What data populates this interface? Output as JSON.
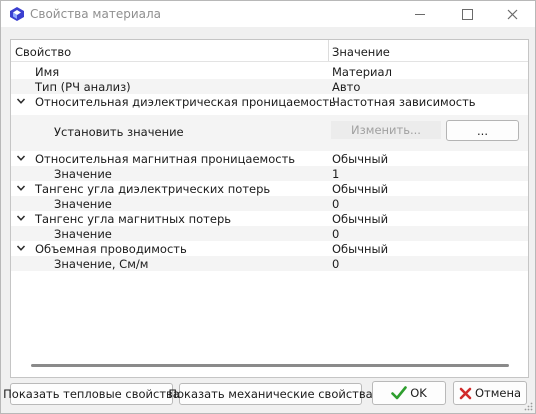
{
  "window": {
    "title": "Свойства материала"
  },
  "grid": {
    "header_property": "Свойство",
    "header_value": "Значение",
    "rows": [
      {
        "label": "Имя",
        "value": "Материал"
      },
      {
        "label": "Тип (РЧ анализ)",
        "value": "Авто"
      },
      {
        "label": "Относительная диэлектрическая проницаемость",
        "value": "Частотная зависимость"
      },
      {
        "label": "Установить значение",
        "value": ""
      },
      {
        "label": "Относительная магнитная проницаемость",
        "value": "Обычный"
      },
      {
        "label": "Значение",
        "value": "1"
      },
      {
        "label": "Тангенс угла диэлектрических потерь",
        "value": "Обычный"
      },
      {
        "label": "Значение",
        "value": "0"
      },
      {
        "label": "Тангенс угла магнитных потерь",
        "value": "Обычный"
      },
      {
        "label": "Значение",
        "value": "0"
      },
      {
        "label": "Объемная проводимость",
        "value": "Обычный"
      },
      {
        "label": "Значение, См/м",
        "value": "0"
      }
    ],
    "edit_button_label": "Изменить...",
    "browse_button_label": "..."
  },
  "footer": {
    "thermal_label": "Показать тепловые свойства",
    "mech_label": "Показать механические свойства",
    "ok_label": "OK",
    "cancel_label": "Отмена"
  },
  "colors": {
    "accent_blue": "#3b3fd0",
    "ok_green": "#2e9e2e",
    "cancel_red": "#d12a2a"
  },
  "icons": [
    "app-icon",
    "minimize-icon",
    "maximize-icon",
    "close-icon",
    "chevron-down-icon",
    "checkmark-icon",
    "cross-icon"
  ]
}
